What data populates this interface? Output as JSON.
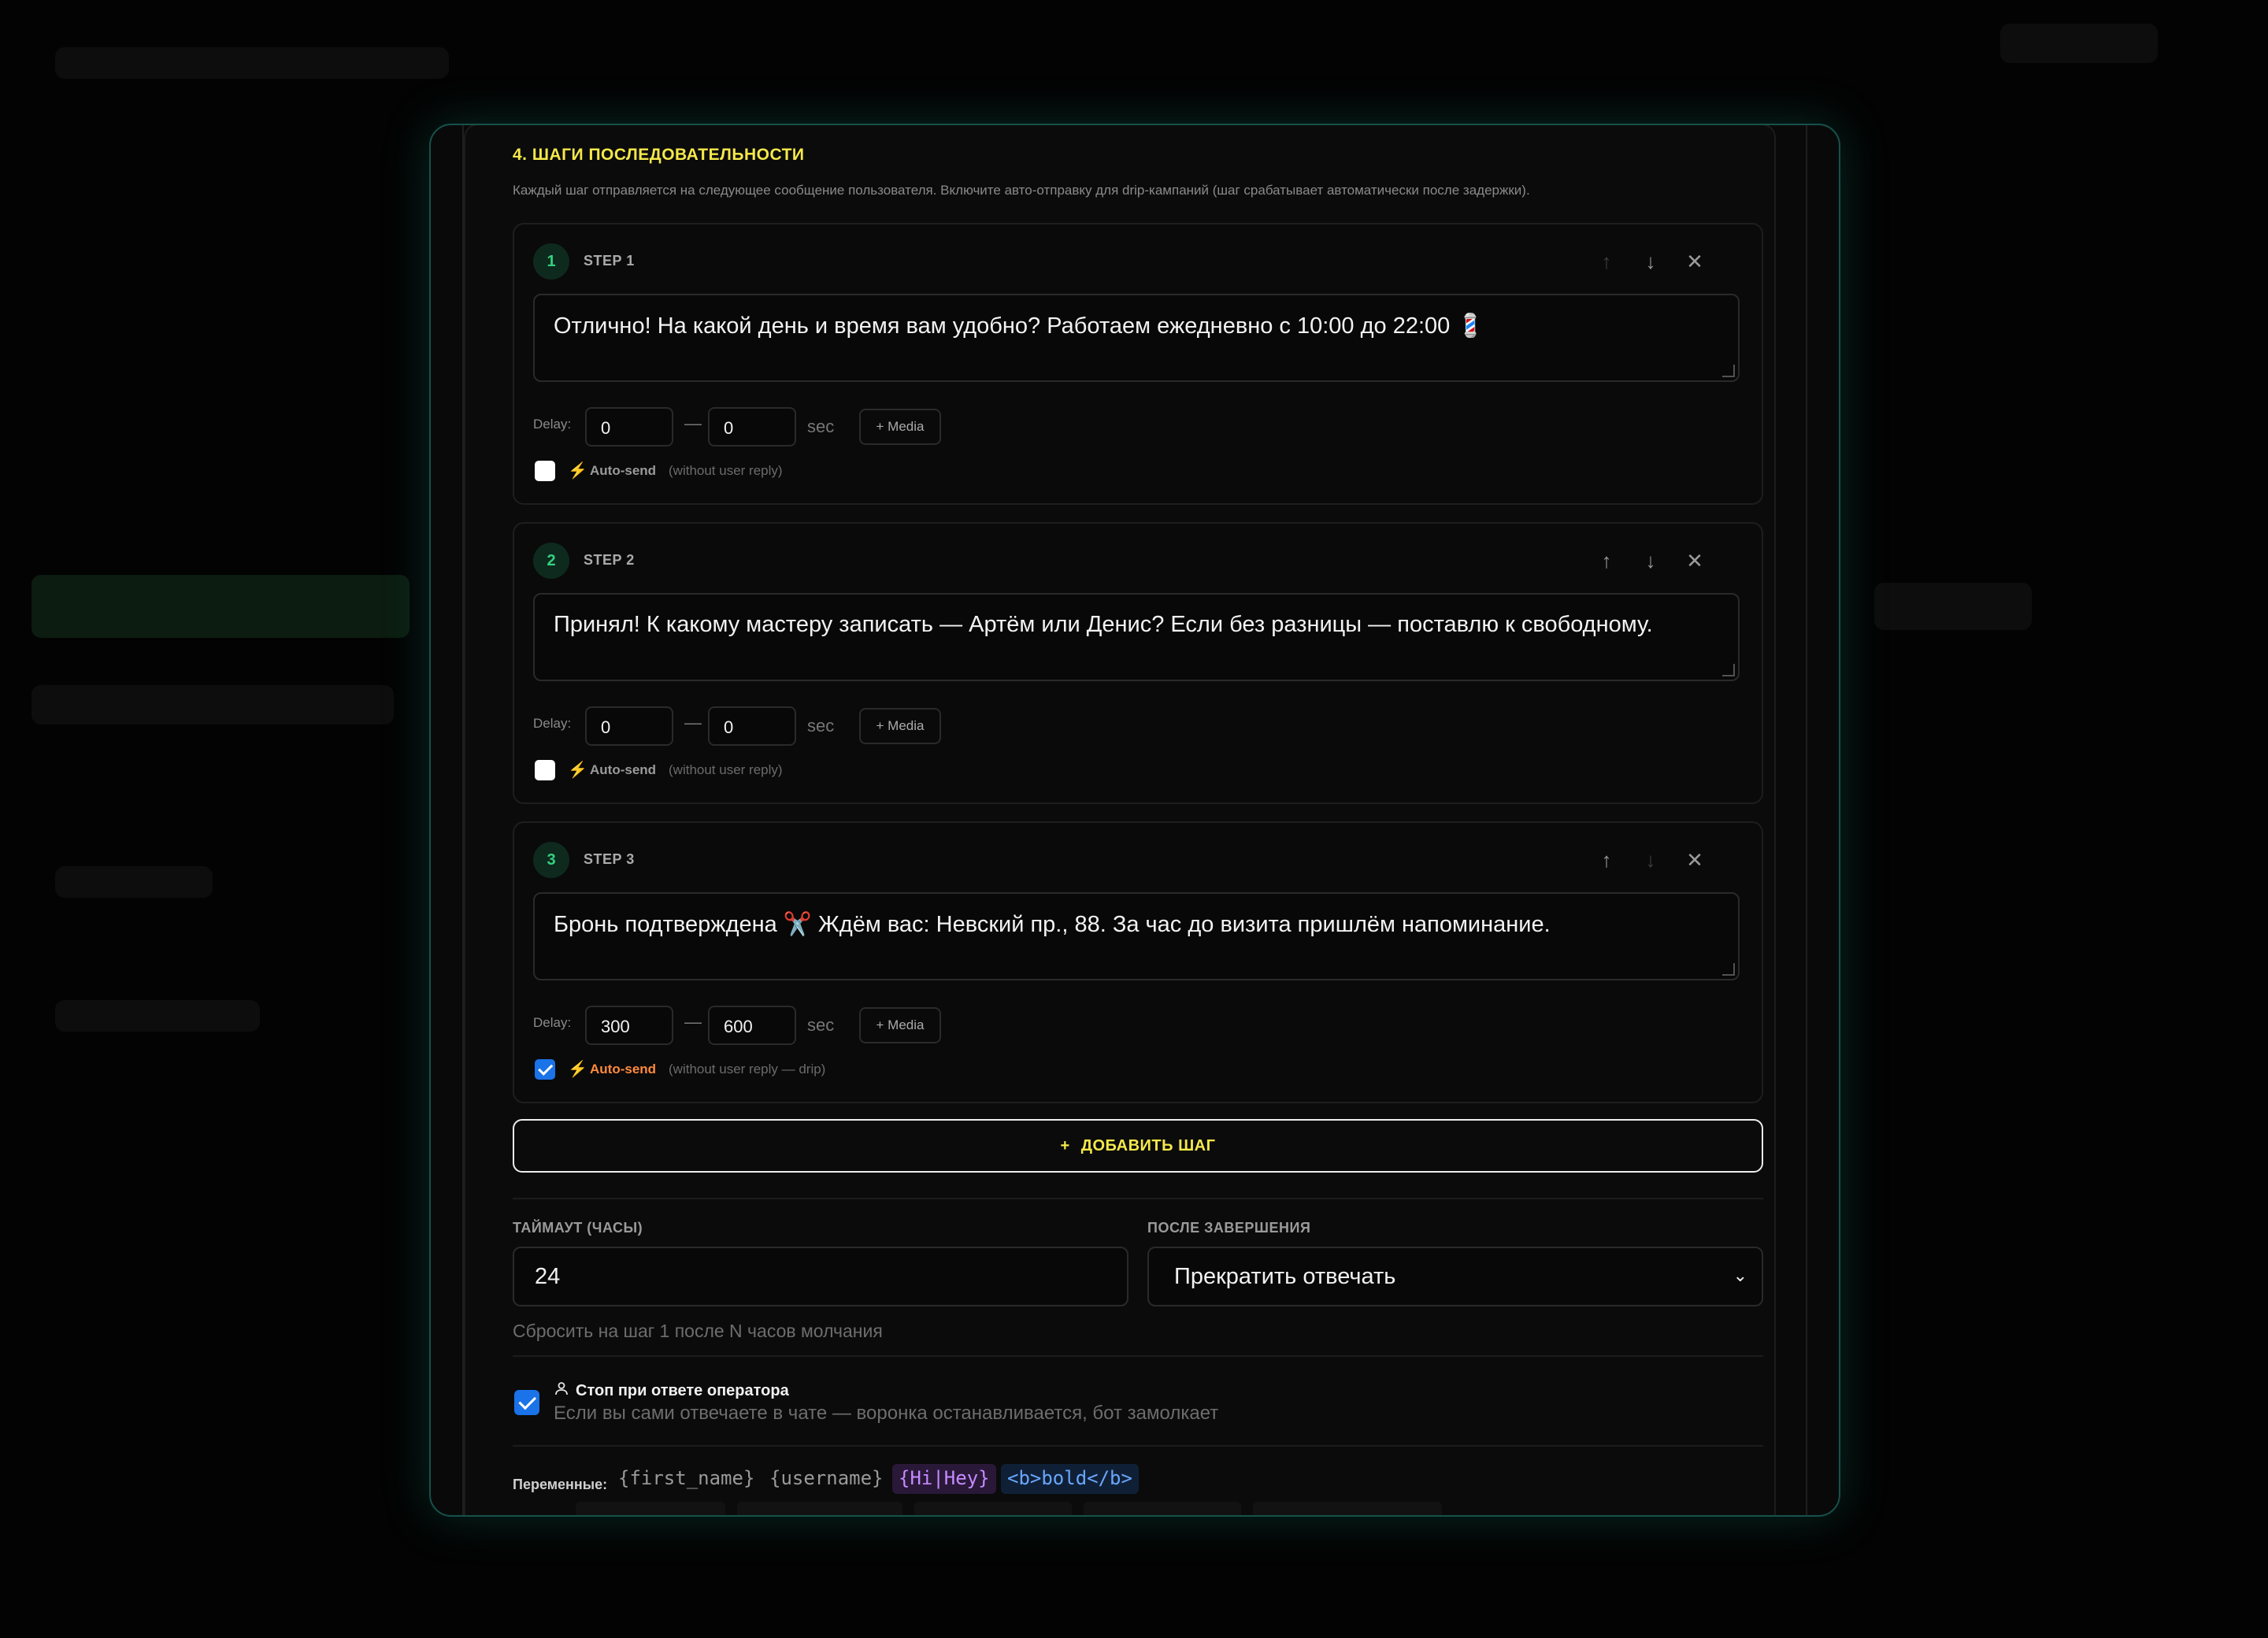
{
  "section": {
    "title": "4. ШАГИ ПОСЛЕДОВАТЕЛЬНОСТИ",
    "description": "Каждый шаг отправляется на следующее сообщение пользователя. Включите авто-отправку для drip-кампаний (шаг срабатывает автоматически после задержки)."
  },
  "steps": [
    {
      "number": "1",
      "label": "STEP 1",
      "message": "Отлично! На какой день и время вам удобно? Работаем ежедневно с 10:00 до 22:00 💈",
      "delay_label": "Delay:",
      "delay_min": "0",
      "delay_max": "0",
      "dash": "—",
      "unit": "sec",
      "media_label": "+ Media",
      "auto_send": false,
      "auto_send_label": "Auto-send",
      "auto_send_note": "(without user reply)",
      "up_enabled": false,
      "down_enabled": true
    },
    {
      "number": "2",
      "label": "STEP 2",
      "message": "Принял! К какому мастеру записать — Артём или Денис? Если без разницы — поставлю к свободному.",
      "delay_label": "Delay:",
      "delay_min": "0",
      "delay_max": "0",
      "dash": "—",
      "unit": "sec",
      "media_label": "+ Media",
      "auto_send": false,
      "auto_send_label": "Auto-send",
      "auto_send_note": "(without user reply)",
      "up_enabled": true,
      "down_enabled": true
    },
    {
      "number": "3",
      "label": "STEP 3",
      "message": "Бронь подтверждена ✂️  Ждём вас: Невский пр., 88. За час до визита пришлём напоминание.",
      "delay_label": "Delay:",
      "delay_min": "300",
      "delay_max": "600",
      "dash": "—",
      "unit": "sec",
      "media_label": "+ Media",
      "auto_send": true,
      "auto_send_label": "Auto-send",
      "auto_send_note": "(without user reply — drip)",
      "up_enabled": true,
      "down_enabled": false
    }
  ],
  "add_step": {
    "icon": "+",
    "label": "ДОБАВИТЬ ШАГ"
  },
  "timeout": {
    "label": "ТАЙМАУТ (ЧАСЫ)",
    "value": "24",
    "hint": "Сбросить на шаг 1 после N часов молчания"
  },
  "after_finish": {
    "label": "ПОСЛЕ ЗАВЕРШЕНИЯ",
    "selected": "Прекратить отвечать"
  },
  "operator_stop": {
    "checked": true,
    "title": "Стоп при ответе оператора",
    "description": "Если вы сами отвечаете в чате — воронка останавливается, бот замолкает"
  },
  "variables": {
    "label": "Переменные:",
    "chips": [
      "{first_name}",
      "{username}",
      "{Hi|Hey}",
      "<b>bold</b>"
    ]
  },
  "colors": {
    "accent_yellow": "#f5e84a",
    "step_green": "#35d07f",
    "auto_orange": "#ff8a3d",
    "checkbox_blue": "#1a73e8",
    "modal_border": "#16514a"
  }
}
